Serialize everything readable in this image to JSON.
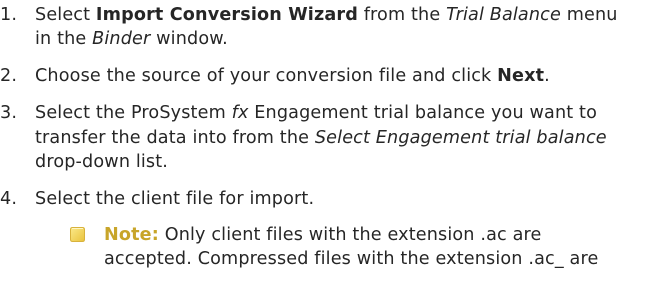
{
  "steps": [
    {
      "number": "1.",
      "line1": {
        "t1": "Select ",
        "b1": "Import Conversion Wizard",
        "t2": " from the ",
        "i1": "Trial Balance",
        "t3": " menu"
      },
      "line2": {
        "t1": "in the ",
        "i1": "Binder",
        "t2": " window."
      }
    },
    {
      "number": "2.",
      "line1": {
        "t1": "Choose the source of your conversion file and click ",
        "b1": "Next",
        "t2": "."
      }
    },
    {
      "number": "3.",
      "line1": {
        "t1": "Select the ProSystem ",
        "i1": "fx",
        "t2": " Engagement trial balance you want to"
      },
      "line2": {
        "t1": "transfer the data into from the ",
        "i1": "Select Engagement trial balance"
      },
      "line3": {
        "t1": "drop-down list."
      }
    },
    {
      "number": "4.",
      "line1": {
        "t1": "Select the client file for import."
      }
    }
  ],
  "note": {
    "icon": "note-icon",
    "label": "Note:",
    "line1": " Only client files with the extension .ac are",
    "line2": "accepted. Compressed files with the extension .ac_ are"
  },
  "colors": {
    "text": "#262626",
    "note_label": "#c8a52a",
    "note_icon": "#f2d45c"
  }
}
